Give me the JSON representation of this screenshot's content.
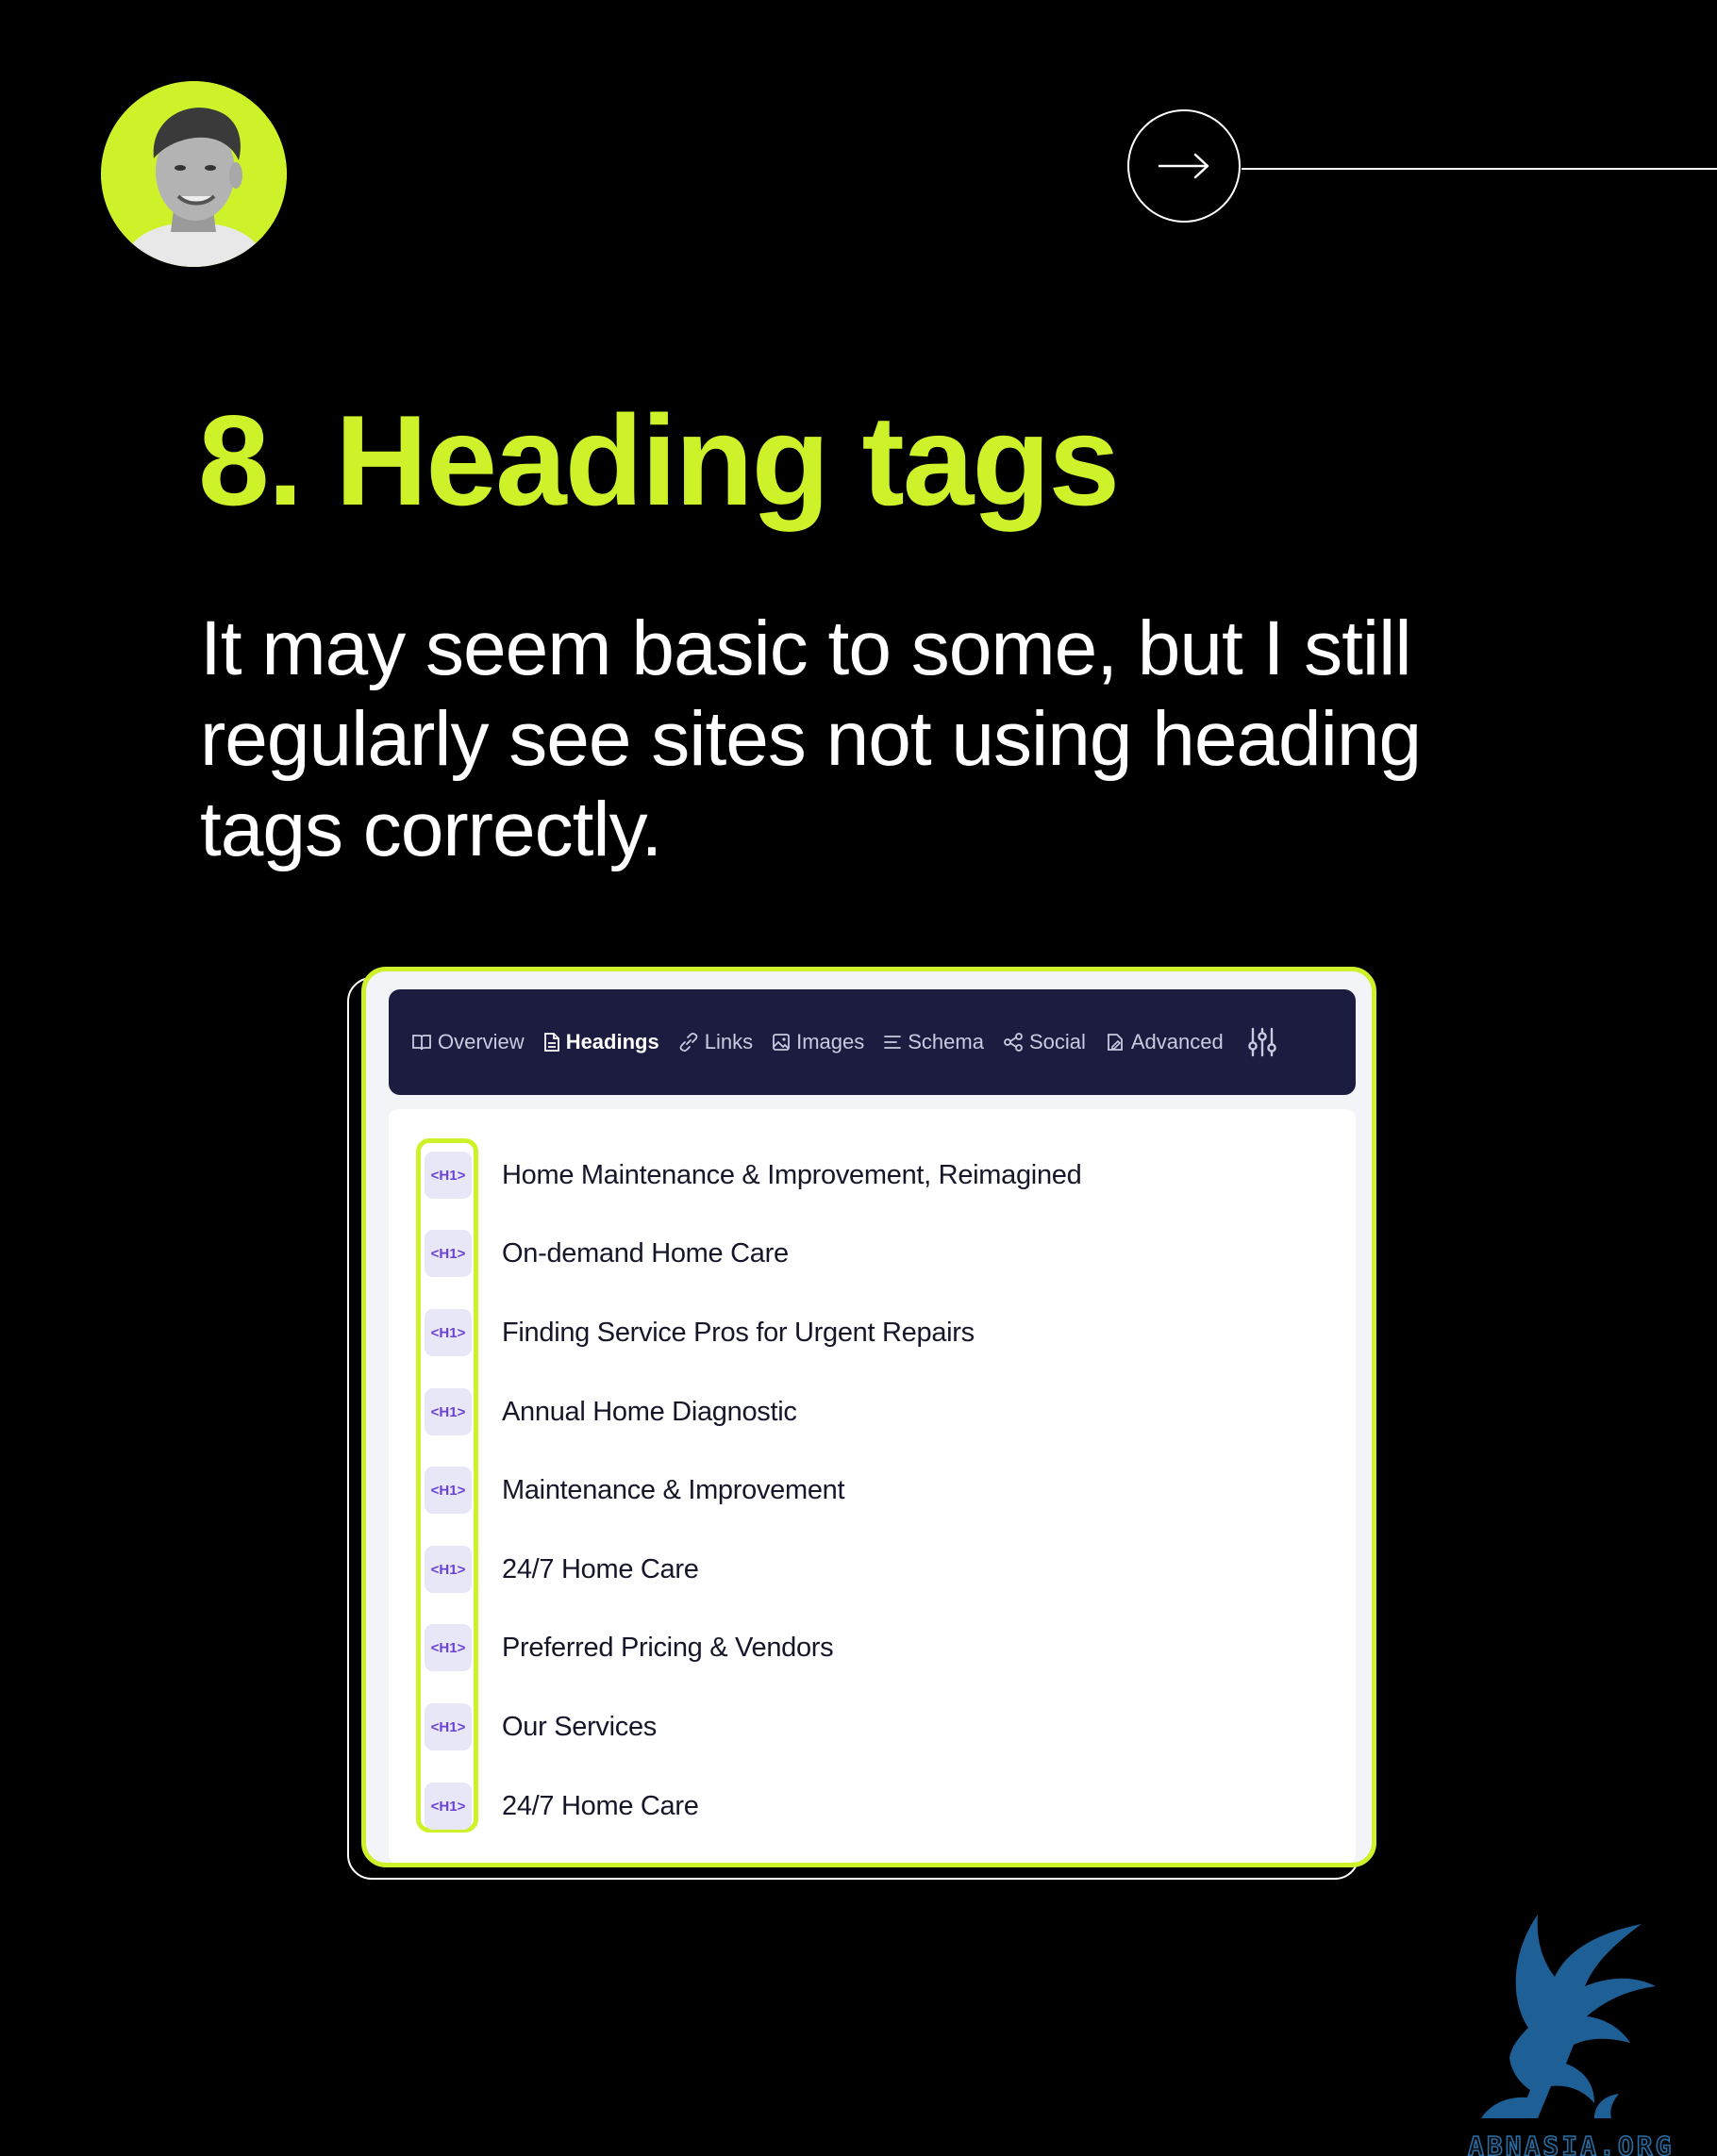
{
  "header": {
    "avatar_alt": "author-avatar"
  },
  "title": "8. Heading tags",
  "body": "It may seem basic to some, but I still regularly see sites not using heading tags correctly.",
  "tabs": [
    {
      "label": "Overview",
      "icon": "book-icon",
      "active": false
    },
    {
      "label": "Headings",
      "icon": "document-icon",
      "active": true
    },
    {
      "label": "Links",
      "icon": "link-icon",
      "active": false
    },
    {
      "label": "Images",
      "icon": "image-icon",
      "active": false
    },
    {
      "label": "Schema",
      "icon": "list-icon",
      "active": false
    },
    {
      "label": "Social",
      "icon": "share-icon",
      "active": false
    },
    {
      "label": "Advanced",
      "icon": "advanced-icon",
      "active": false
    }
  ],
  "headings": [
    {
      "tag": "<H1>",
      "text": "Home Maintenance & Improvement, Reimagined"
    },
    {
      "tag": "<H1>",
      "text": "On-demand Home Care"
    },
    {
      "tag": "<H1>",
      "text": "Finding Service Pros for Urgent Repairs"
    },
    {
      "tag": "<H1>",
      "text": "Annual Home Diagnostic"
    },
    {
      "tag": "<H1>",
      "text": "Maintenance & Improvement"
    },
    {
      "tag": "<H1>",
      "text": "24/7 Home Care"
    },
    {
      "tag": "<H1>",
      "text": "Preferred Pricing & Vendors"
    },
    {
      "tag": "<H1>",
      "text": "Our Services"
    },
    {
      "tag": "<H1>",
      "text": "24/7 Home Care"
    }
  ],
  "watermark": "ABNASIA.ORG",
  "colors": {
    "accent": "#cdf22a",
    "background": "#000000",
    "tabbar": "#1c1c40",
    "badge_bg": "#e7e7f7",
    "badge_text": "#6b42d6",
    "watermark": "#2a6ea8"
  }
}
